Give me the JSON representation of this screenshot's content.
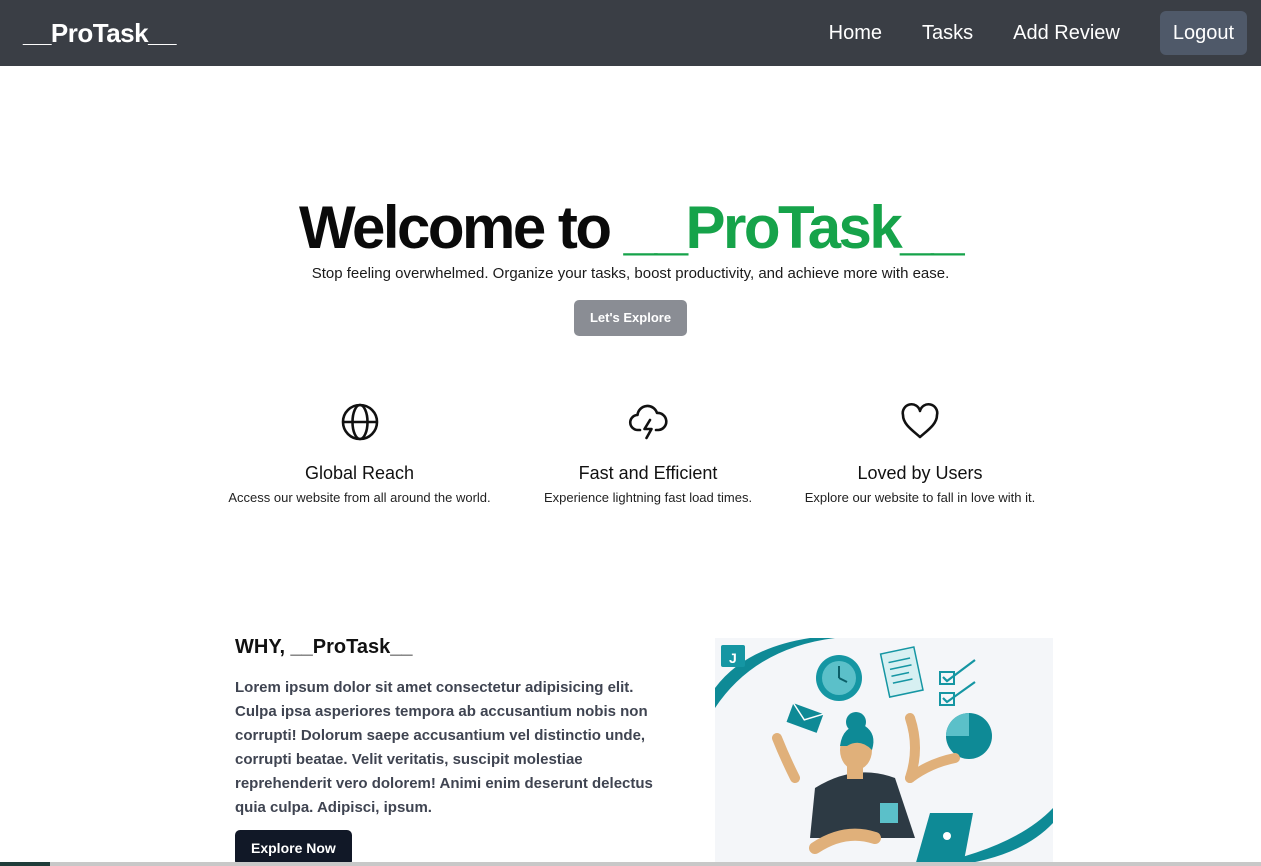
{
  "nav": {
    "brand": "__ProTask__",
    "links": [
      "Home",
      "Tasks",
      "Add Review"
    ],
    "logout": "Logout"
  },
  "hero": {
    "title_prefix": "Welcome to ",
    "title_accent": "__ProTask__",
    "subtitle": "Stop feeling overwhelmed. Organize your tasks, boost productivity, and achieve more with ease.",
    "button": "Let's Explore"
  },
  "features": [
    {
      "icon": "globe-icon",
      "title": "Global Reach",
      "desc": "Access our website from all around the world."
    },
    {
      "icon": "lightning-cloud-icon",
      "title": "Fast and Efficient",
      "desc": "Experience lightning fast load times."
    },
    {
      "icon": "heart-icon",
      "title": "Loved by Users",
      "desc": "Explore our website to fall in love with it."
    }
  ],
  "why": {
    "title": "WHY, __ProTask__",
    "body": "Lorem ipsum dolor sit amet consectetur adipisicing elit. Culpa ipsa asperiores tempora ab accusantium nobis non corrupti! Dolorum saepe accusantium vel distinctio unde, corrupti beatae. Velit veritatis, suscipit molestiae reprehenderit vero dolorem! Animi enim deserunt delectus quia culpa. Adipisci, ipsum.",
    "button": "Explore Now"
  },
  "colors": {
    "navbar": "#3a3e45",
    "accent": "#16a34a",
    "illustration_teal": "#0e8a96"
  }
}
